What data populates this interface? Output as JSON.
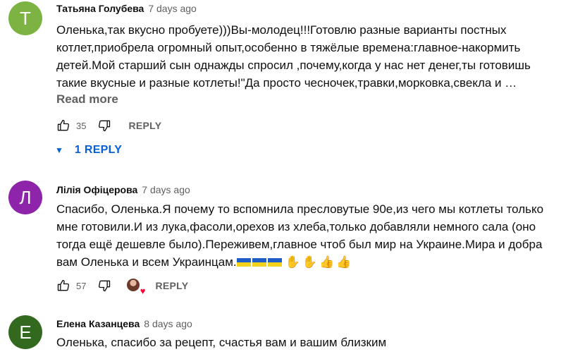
{
  "comments": [
    {
      "avatar_letter": "Т",
      "avatar_color": "#7cb342",
      "author": "Татьяна Голубева",
      "time": "7 days ago",
      "lines": [
        "Оленька,так вкусно пробуете)))Вы-молодец!!!Готовлю разные варианты постных",
        "котлет,приобрела огромный опыт,особенно в тяжёлые времена:главное-накормить",
        "детей.Мой старший сын однажды спросил ,почему,когда у нас нет денег,ты готовишь",
        "такие вкусные и разные котлеты!\"Да просто чесночек,травки,морковка,свекла и …"
      ],
      "read_more": "Read more",
      "likes": "35",
      "reply_label": "REPLY",
      "replies_toggle": "1 REPLY"
    },
    {
      "avatar_letter": "Л",
      "avatar_color": "#8e24aa",
      "author": "Лілія Офіцерова",
      "time": "7 days ago",
      "lines": [
        "Спасибо, Оленька.Я почему то вспомнила пресловутые 90е,из чего мы котлеты только",
        "мне готовили.И из лука,фасоли,орехов из хлеба,только добавляли немного сала (оно",
        "тогда ещё дешевле было).Переживем,главное чтоб был мир на Украине.Мира и добра"
      ],
      "last_line": "вам Оленька и всем Украинцам.",
      "likes": "57",
      "reply_label": "REPLY"
    },
    {
      "avatar_letter": "Е",
      "avatar_color": "#33691e",
      "author": "Елена Казанцева",
      "time": "8 days ago",
      "lines": [
        "Оленька, спасибо за рецепт, счастья вам и вашим близким"
      ]
    }
  ],
  "icons": {
    "like": "thumbs-up-icon",
    "dislike": "thumbs-down-icon",
    "caret": "caret-down-icon",
    "creator_heart": "creator-heart-icon"
  },
  "colors": {
    "link_blue": "#065fd4",
    "secondary_text": "#606060",
    "heart": "#ff0033"
  }
}
